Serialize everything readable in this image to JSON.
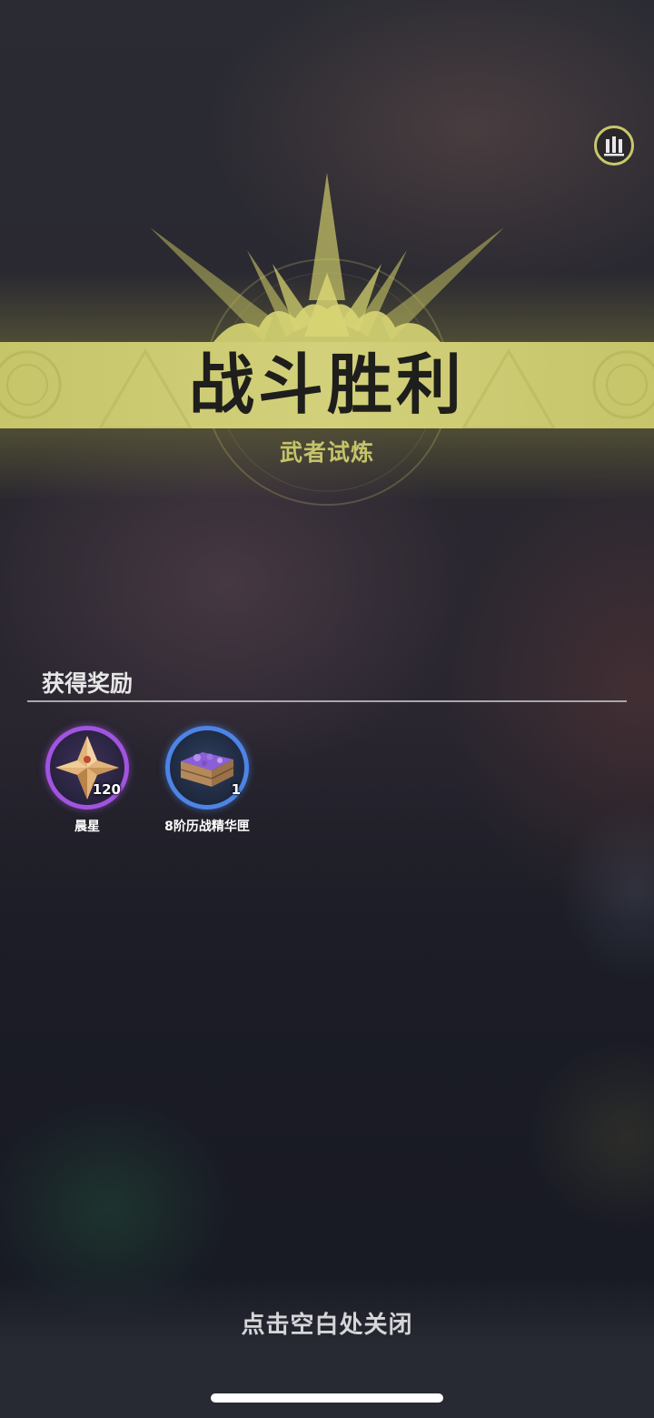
{
  "result": {
    "title": "战斗胜利",
    "subtitle": "武者试炼"
  },
  "toolbar": {
    "stats_icon": "bar-chart-icon"
  },
  "rewards": {
    "header": "获得奖励",
    "items": [
      {
        "name": "晨星",
        "count": "120",
        "rarity_color": "#a154e0",
        "icon": "morning-star-crystal-icon"
      },
      {
        "name": "8阶历战精华匣",
        "count": "1",
        "rarity_color": "#4d84e6",
        "icon": "essence-crate-icon"
      }
    ]
  },
  "footer": {
    "close_hint": "点击空白处关闭"
  },
  "colors": {
    "accent": "#c7c56a",
    "title_text": "#1e1e1c"
  }
}
